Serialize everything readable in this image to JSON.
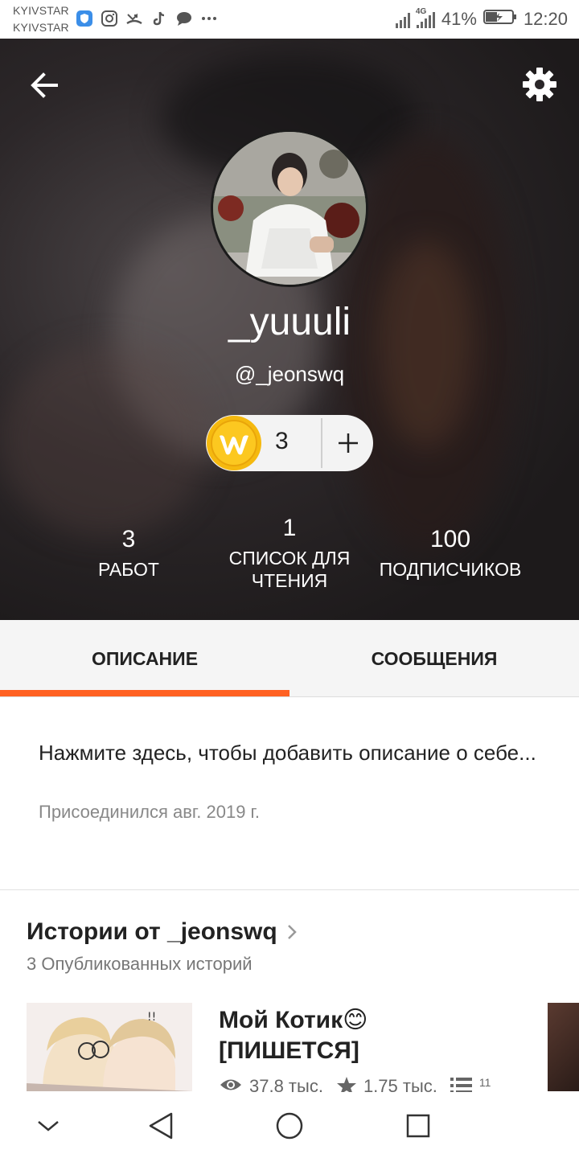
{
  "status_bar": {
    "carrier1": "KYIVSTAR",
    "carrier2": "KYIVSTAR",
    "network": "4G",
    "battery": "41%",
    "time": "12:20"
  },
  "profile": {
    "display_name": "_yuuuli",
    "username": "@_jeonswq",
    "coins": "3"
  },
  "stats": {
    "works": {
      "value": "3",
      "label": "РАБОТ"
    },
    "reading_lists": {
      "value": "1",
      "label": "СПИСОК ДЛЯ ЧТЕНИЯ"
    },
    "followers": {
      "value": "100",
      "label": "ПОДПИСЧИКОВ"
    }
  },
  "tabs": [
    {
      "label": "ОПИСАНИЕ",
      "active": true
    },
    {
      "label": "СООБЩЕНИЯ",
      "active": false
    }
  ],
  "about": {
    "prompt": "Нажмите здесь, чтобы добавить описание о себе...",
    "joined": "Присоединился авг. 2019 г."
  },
  "stories": {
    "title": "Истории от _jeonswq",
    "subtitle": "3 Опубликованных историй",
    "items": [
      {
        "title": "Мой Котик😊 [ПИШЕТСЯ]",
        "reads": "37,8 тыс.",
        "votes": "1,75 тыс.",
        "parts": "11"
      }
    ]
  },
  "colors": {
    "accent": "#ff6122",
    "coin": "#f5b90f"
  },
  "icons": {
    "back": "arrow-left-icon",
    "settings": "gear-icon",
    "coin": "wattpad-coin-icon",
    "add": "plus-icon",
    "chevron": "chevron-right-icon",
    "reads": "eye-icon",
    "votes": "star-icon",
    "parts": "list-icon"
  }
}
